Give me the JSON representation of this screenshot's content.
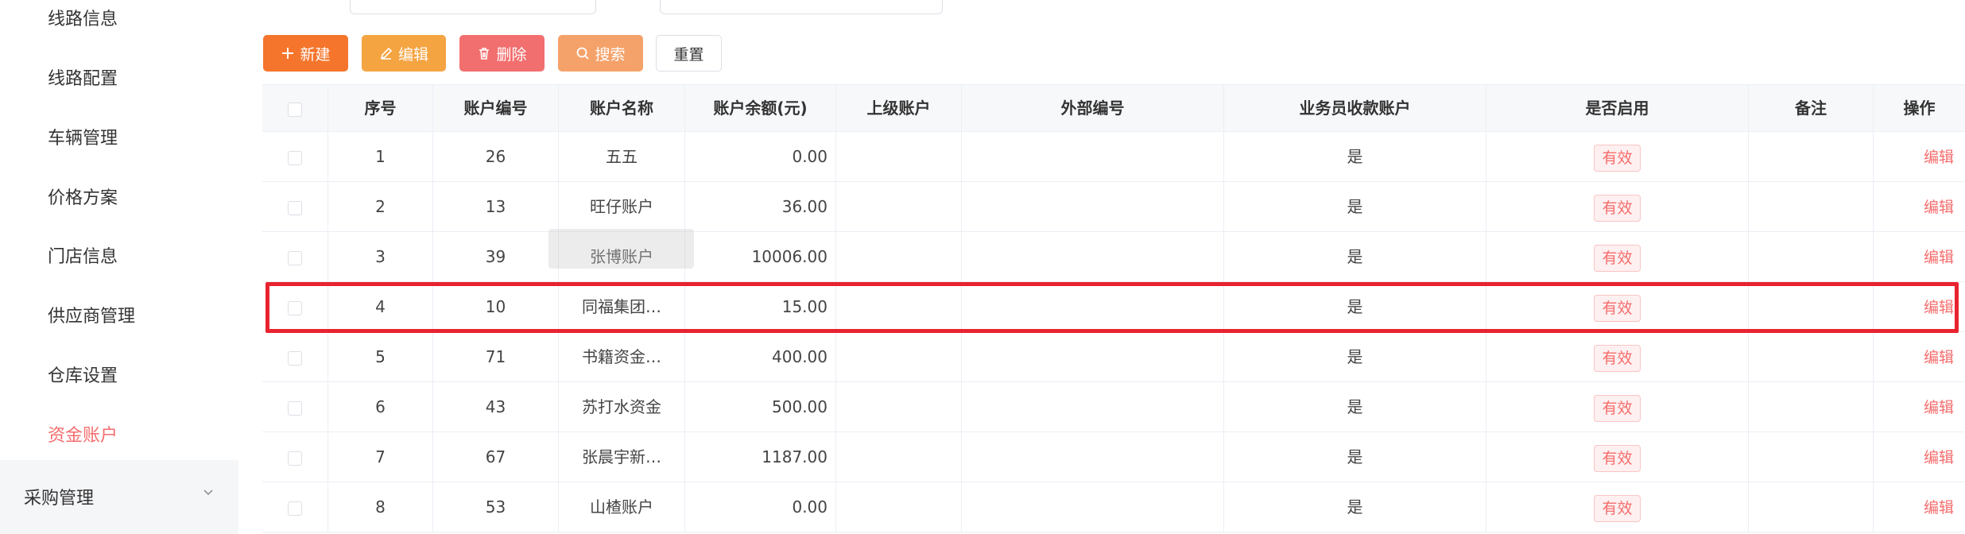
{
  "sidebar": {
    "items": [
      {
        "label": "线路信息",
        "active": false
      },
      {
        "label": "线路配置",
        "active": false
      },
      {
        "label": "车辆管理",
        "active": false
      },
      {
        "label": "价格方案",
        "active": false
      },
      {
        "label": "门店信息",
        "active": false
      },
      {
        "label": "供应商管理",
        "active": false
      },
      {
        "label": "仓库设置",
        "active": false
      },
      {
        "label": "资金账户",
        "active": true
      }
    ],
    "group": {
      "label": "采购管理",
      "icon": "chevron-down-icon"
    }
  },
  "toolbar": {
    "new_label": "新建",
    "edit_label": "编辑",
    "delete_label": "删除",
    "search_label": "搜索",
    "reset_label": "重置",
    "icons": [
      "plus-icon",
      "edit-icon",
      "trash-icon",
      "search-icon"
    ]
  },
  "table": {
    "headers": [
      "序号",
      "账户编号",
      "账户名称",
      "账户余额(元)",
      "上级账户",
      "外部编号",
      "业务员收款账户",
      "是否启用",
      "备注",
      "操作"
    ],
    "rows": [
      {
        "seq": "1",
        "code": "26",
        "name": "五五",
        "balance": "0.00",
        "parent": "",
        "external": "",
        "salesman": "是",
        "enabled": "有效",
        "remark": "",
        "action": "编辑"
      },
      {
        "seq": "2",
        "code": "13",
        "name": "旺仔账户",
        "balance": "36.00",
        "parent": "",
        "external": "",
        "salesman": "是",
        "enabled": "有效",
        "remark": "",
        "action": "编辑"
      },
      {
        "seq": "3",
        "code": "39",
        "name": "张博账户",
        "balance": "10006.00",
        "parent": "",
        "external": "",
        "salesman": "是",
        "enabled": "有效",
        "remark": "",
        "action": "编辑"
      },
      {
        "seq": "4",
        "code": "10",
        "name": "同福集团…",
        "balance": "15.00",
        "parent": "",
        "external": "",
        "salesman": "是",
        "enabled": "有效",
        "remark": "",
        "action": "编辑"
      },
      {
        "seq": "5",
        "code": "71",
        "name": "书籍资金…",
        "balance": "400.00",
        "parent": "",
        "external": "",
        "salesman": "是",
        "enabled": "有效",
        "remark": "",
        "action": "编辑"
      },
      {
        "seq": "6",
        "code": "43",
        "name": "苏打水资金",
        "balance": "500.00",
        "parent": "",
        "external": "",
        "salesman": "是",
        "enabled": "有效",
        "remark": "",
        "action": "编辑"
      },
      {
        "seq": "7",
        "code": "67",
        "name": "张晨宇新…",
        "balance": "1187.00",
        "parent": "",
        "external": "",
        "salesman": "是",
        "enabled": "有效",
        "remark": "",
        "action": "编辑"
      },
      {
        "seq": "8",
        "code": "53",
        "name": "山楂账户",
        "balance": "0.00",
        "parent": "",
        "external": "",
        "salesman": "是",
        "enabled": "有效",
        "remark": "",
        "action": "编辑"
      }
    ],
    "highlighted_row": 4
  },
  "colors": {
    "accent": "#f56c6c",
    "new_button": "#f5752c",
    "edit_button": "#f5a442",
    "delete_button": "#f26f6f",
    "search_button": "#f5a26a",
    "highlight_border": "#e8232f"
  }
}
